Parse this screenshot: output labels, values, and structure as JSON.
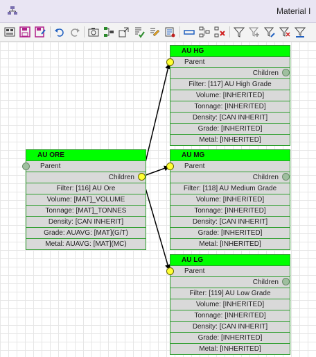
{
  "window": {
    "title": "Material I"
  },
  "toolbar": {
    "icons": [
      "layout-icon",
      "save-icon",
      "save-as-icon",
      "undo-icon",
      "redo-icon",
      "screenshot-icon",
      "auto-layout-icon",
      "resize-icon",
      "validate-icon",
      "edit-icon",
      "properties-icon",
      "collapse-icon",
      "connect-icon",
      "delete-node-icon",
      "filter-icon",
      "filter-add-icon",
      "filter-edit-icon",
      "filter-remove-icon",
      "filter-clear-icon"
    ]
  },
  "nodes": {
    "au_ore": {
      "title": "AU ORE",
      "parent": "Parent",
      "children": "Children",
      "props": [
        "Filter: [116] AU Ore",
        "Volume: [MAT]_VOLUME",
        "Tonnage: [MAT]_TONNES",
        "Density: [CAN INHERIT]",
        "Grade: AUAVG: [MAT](G/T)",
        "Metal: AUAVG: [MAT](MC)"
      ]
    },
    "au_hg": {
      "title": "AU HG",
      "parent": "Parent",
      "children": "Children",
      "props": [
        "Filter: [117] AU High Grade",
        "Volume: [INHERITED]",
        "Tonnage: [INHERITED]",
        "Density: [CAN INHERIT]",
        "Grade: [INHERITED]",
        "Metal: [INHERITED]"
      ]
    },
    "au_mg": {
      "title": "AU MG",
      "parent": "Parent",
      "children": "Children",
      "props": [
        "Filter: [118] AU Medium Grade",
        "Volume: [INHERITED]",
        "Tonnage: [INHERITED]",
        "Density: [CAN INHERIT]",
        "Grade: [INHERITED]",
        "Metal: [INHERITED]"
      ]
    },
    "au_lg": {
      "title": "AU LG",
      "parent": "Parent",
      "children": "Children",
      "props": [
        "Filter: [119] AU Low Grade",
        "Volume: [INHERITED]",
        "Tonnage: [INHERITED]",
        "Density: [CAN INHERIT]",
        "Grade: [INHERITED]",
        "Metal: [INHERITED]"
      ]
    }
  },
  "colors": {
    "header": "#00ff00",
    "border": "#2e9e2e",
    "row": "#d9d9d9",
    "port_active": "#ffff33"
  }
}
